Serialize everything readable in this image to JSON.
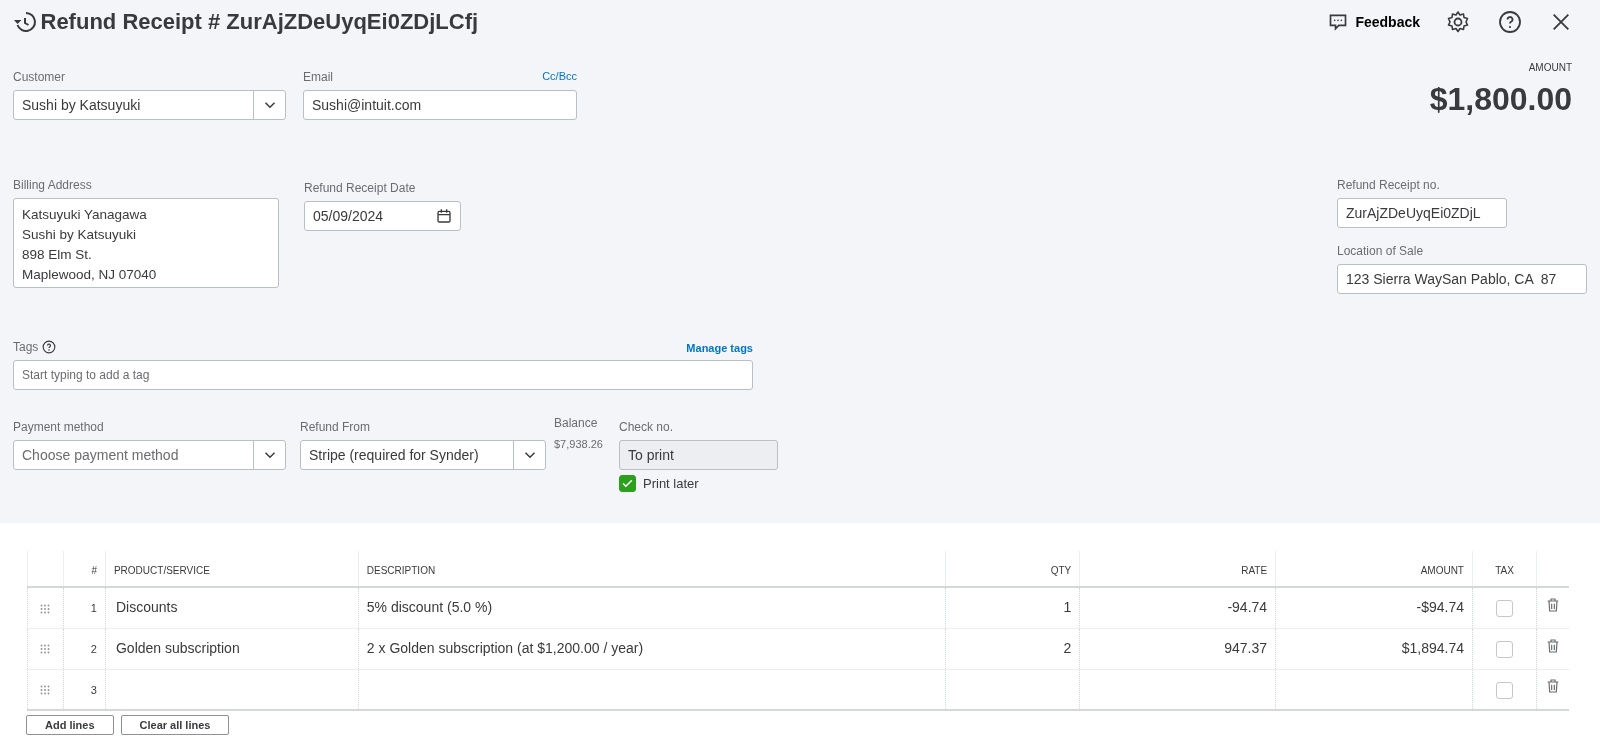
{
  "header": {
    "title": "Refund Receipt # ZurAjZDeUyqEi0ZDjLCfj",
    "feedback": "Feedback"
  },
  "amount": {
    "label": "AMOUNT",
    "value": "$1,800.00"
  },
  "customer": {
    "label": "Customer",
    "value": "Sushi by Katsuyuki"
  },
  "email": {
    "label": "Email",
    "link": "Cc/Bcc",
    "value": "Sushi@intuit.com"
  },
  "billing_address": {
    "label": "Billing Address",
    "lines": [
      "Katsuyuki Yanagawa",
      "Sushi by Katsuyuki",
      "898 Elm St.",
      "Maplewood, NJ  07040"
    ]
  },
  "date": {
    "label": "Refund Receipt Date",
    "value": "05/09/2024"
  },
  "receipt_no": {
    "label": "Refund Receipt no.",
    "value": "ZurAjZDeUyqEi0ZDjL"
  },
  "location": {
    "label": "Location of Sale",
    "value": "123 Sierra WaySan Pablo, CA  87"
  },
  "tags": {
    "label": "Tags",
    "link": "Manage tags",
    "placeholder": "Start typing to add a tag"
  },
  "payment_method": {
    "label": "Payment method",
    "placeholder": "Choose payment method"
  },
  "refund_from": {
    "label": "Refund From",
    "value": "Stripe (required for Synder)"
  },
  "balance": {
    "label": "Balance",
    "value": "$7,938.26"
  },
  "check_no": {
    "label": "Check no.",
    "value": "To print"
  },
  "print_later": {
    "label": "Print later",
    "checked": true
  },
  "table": {
    "columns": [
      "#",
      "PRODUCT/SERVICE",
      "DESCRIPTION",
      "QTY",
      "RATE",
      "AMOUNT",
      "TAX"
    ],
    "rows": [
      {
        "number": "1",
        "product": "Discounts",
        "description": "5% discount (5.0 %)",
        "qty": "1",
        "rate": "-94.74",
        "amount": "-$94.74",
        "tax": false
      },
      {
        "number": "2",
        "product": "Golden subscription",
        "description": "2 x Golden subscription (at $1,200.00 / year)",
        "qty": "2",
        "rate": "947.37",
        "amount": "$1,894.74",
        "tax": false
      },
      {
        "number": "3",
        "tax": false
      }
    ]
  },
  "buttons": [
    "Add lines",
    "Clear all lines"
  ]
}
